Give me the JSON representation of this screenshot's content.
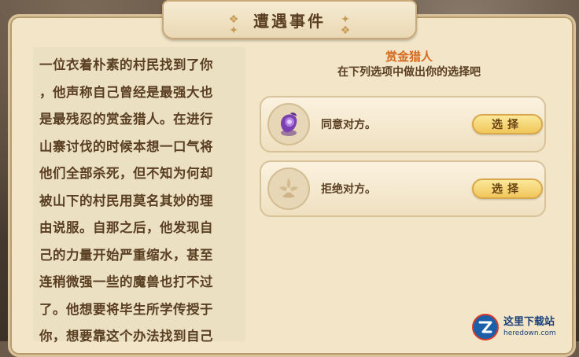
{
  "dialog": {
    "title": "遭遇事件"
  },
  "story": {
    "lines": [
      "一位衣着朴素的村民找到了你",
      "，他声称自己曾经是最强大也",
      "是最残忍的赏金猎人。在进行",
      "山寨讨伐的时候本想一口气将",
      "他们全部杀死，但不知为何却",
      "被山下的村民用莫名其妙的理",
      "由说服。自那之后，他发现自",
      "己的力量开始严重缩水，甚至",
      "连稍微强一些的魔兽也打不过",
      "了。他想要将毕生所学传授于",
      "你，想要靠这个办法找到自己"
    ]
  },
  "event": {
    "npc_name": "赏金猎人",
    "prompt": "在下列选项中做出你的选择吧"
  },
  "options": [
    {
      "label": "同意对方。",
      "button": "选择",
      "icon": "purple-orb-icon"
    },
    {
      "label": "拒绝对方。",
      "button": "选择",
      "icon": "refuse-emblem-icon"
    }
  ],
  "watermark": {
    "title": "这里下载站",
    "url": "heredown.com"
  },
  "colors": {
    "accent_orange": "#d56a1e",
    "text_brown": "#5a3e22",
    "panel_bg": "#f3e6c8",
    "button_gold": "#f0c65a"
  }
}
